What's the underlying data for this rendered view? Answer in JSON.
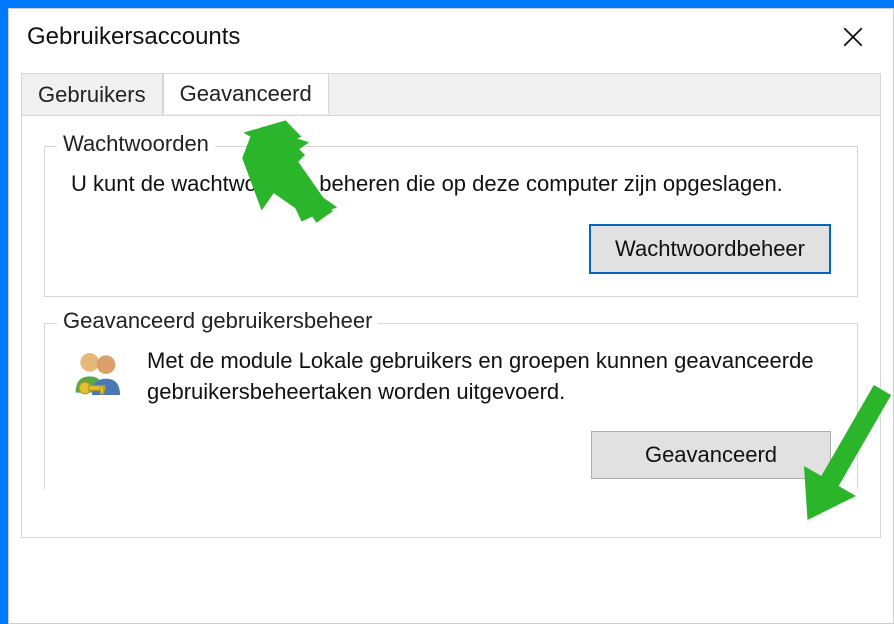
{
  "dialog": {
    "title": "Gebruikersaccounts"
  },
  "tabs": {
    "users": "Gebruikers",
    "advanced": "Geavanceerd"
  },
  "passwords_group": {
    "legend": "Wachtwoorden",
    "text": "U kunt de wachtwoorden beheren die op deze computer zijn opgeslagen.",
    "button": "Wachtwoordbeheer"
  },
  "advanced_group": {
    "legend": "Geavanceerd gebruikersbeheer",
    "text": "Met de module Lokale gebruikers en groepen kunnen geavanceerde gebruikersbeheertaken worden uitgevoerd.",
    "button": "Geavanceerd"
  }
}
